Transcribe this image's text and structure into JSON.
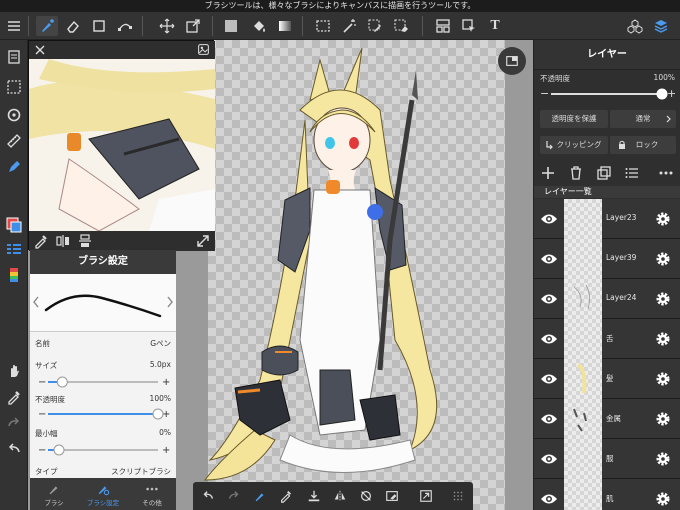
{
  "statusbar": {
    "hint": "ブラシツールは、様々なブラシによりキャンバスに描画を行うツールです。"
  },
  "toolbar": {
    "text_tool_glyph": "T"
  },
  "navigator": {},
  "brush_settings": {
    "title": "ブラシ設定",
    "params": [
      {
        "label": "名前",
        "value": "Gペン"
      },
      {
        "label": "サイズ",
        "value": "5.0px",
        "level": 0.13
      },
      {
        "label": "不透明度",
        "value": "100%",
        "level": 1.0
      },
      {
        "label": "最小幅",
        "value": "0%",
        "level": 0.1
      },
      {
        "label": "タイプ",
        "value": "スクリプトブラシ"
      }
    ],
    "tabs": [
      {
        "label": "ブラシ"
      },
      {
        "label": "ブラシ設定",
        "active": true
      },
      {
        "label": "その他"
      }
    ]
  },
  "layer_panel": {
    "title": "レイヤー",
    "opacity_label": "不透明度",
    "opacity_value": "100%",
    "opacity_level": 1.0,
    "protect_label": "透明度を保護",
    "blend_mode": "通常",
    "clipping_label": "クリッピング",
    "lock_label": "ロック",
    "list_title": "レイヤー一覧",
    "layers": [
      {
        "name": "Layer23"
      },
      {
        "name": "Layer39"
      },
      {
        "name": "Layer24"
      },
      {
        "name": "舌"
      },
      {
        "name": "髪"
      },
      {
        "name": "金属"
      },
      {
        "name": "服"
      },
      {
        "name": "肌"
      }
    ]
  },
  "colors": {
    "accent": "#3f8ee8",
    "panel": "#2f2f2f",
    "canvas_bg": "#9a9a9a"
  }
}
